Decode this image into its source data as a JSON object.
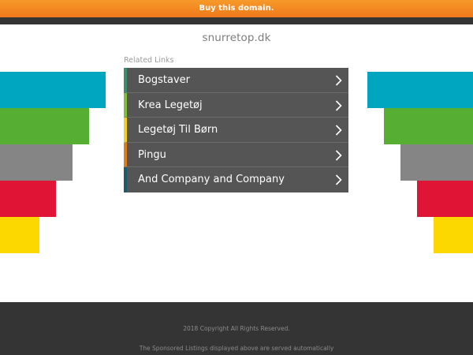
{
  "banner": {
    "label": "Buy this domain."
  },
  "site": {
    "domain": "snurretop.dk"
  },
  "related": {
    "heading": "Related Links",
    "links": [
      {
        "label": "Bogstaver",
        "accent": "#3d8c6c"
      },
      {
        "label": "Krea Legetøj",
        "accent": "#7fbf3a"
      },
      {
        "label": "Legetøj Til Børn",
        "accent": "#f0d020"
      },
      {
        "label": "Pingu",
        "accent": "#d87e1c"
      },
      {
        "label": "And Company and Company",
        "accent": "#1e5a6e"
      }
    ]
  },
  "decor": {
    "bar_colors": [
      "#00a6c0",
      "#56ae33",
      "#858585",
      "#e01536",
      "#fdd800"
    ]
  },
  "footer": {
    "copyright": "2018 Copyright All Rights Reserved.",
    "disclaimer": "The Sponsored Listings displayed above are served automatically"
  }
}
